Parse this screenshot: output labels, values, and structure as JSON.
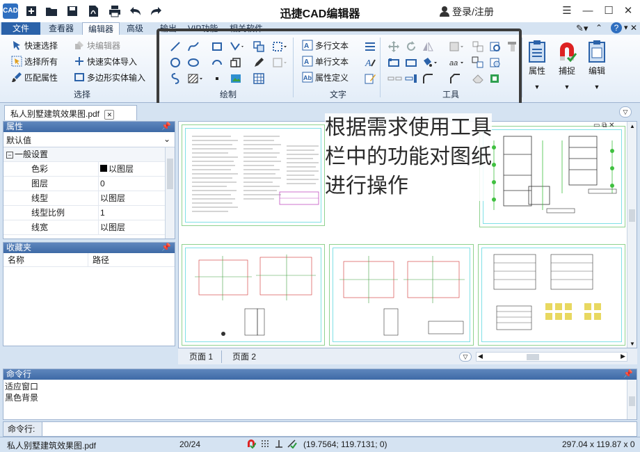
{
  "app": {
    "title": "迅捷CAD编辑器",
    "logo_text": "CAD",
    "login_label": "登录/注册"
  },
  "quick_access": [
    "new-icon",
    "open-icon",
    "save-icon",
    "export-pdf-icon",
    "print-icon",
    "undo-icon",
    "redo-icon"
  ],
  "window_controls": [
    "menu-icon",
    "minimize-icon",
    "maximize-icon",
    "close-icon"
  ],
  "tabs": [
    {
      "label": "文件"
    },
    {
      "label": "查看器"
    },
    {
      "label": "编辑器"
    },
    {
      "label": "高级"
    },
    {
      "label": "输出"
    },
    {
      "label": "VIP功能"
    },
    {
      "label": "相关软件"
    }
  ],
  "active_tab": "编辑器",
  "ribbon": {
    "select_group": {
      "label": "选择",
      "items": [
        {
          "label": "快速选择",
          "enabled": true
        },
        {
          "label": "块编辑器",
          "enabled": false
        },
        {
          "label": "选择所有",
          "enabled": true
        },
        {
          "label": "快速实体导入",
          "enabled": true
        },
        {
          "label": "匹配属性",
          "enabled": true
        },
        {
          "label": "多边形实体输入",
          "enabled": true
        }
      ]
    },
    "draw_group": {
      "label": "绘制"
    },
    "text_group": {
      "label": "文字",
      "items": [
        {
          "label": "多行文本"
        },
        {
          "label": "单行文本"
        },
        {
          "label": "属性定义"
        }
      ]
    },
    "tools_group": {
      "label": "工具"
    },
    "big_buttons": [
      {
        "label": "属性"
      },
      {
        "label": "捕捉"
      },
      {
        "label": "编辑"
      }
    ]
  },
  "document_tab": "私人别墅建筑效果图.pdf",
  "properties_panel": {
    "title": "属性",
    "combo_value": "默认值",
    "section": "一般设置",
    "rows": [
      {
        "key": "色彩",
        "value": "以图层"
      },
      {
        "key": "图层",
        "value": "0"
      },
      {
        "key": "线型",
        "value": "以图层"
      },
      {
        "key": "线型比例",
        "value": "1"
      },
      {
        "key": "线宽",
        "value": "以图层"
      }
    ]
  },
  "favorites_panel": {
    "title": "收藏夹",
    "columns": [
      "名称",
      "路径"
    ]
  },
  "annotation_text": "根据需求使用工具栏中的功能对图纸进行操作",
  "page_tabs": [
    "页面 1",
    "页面 2"
  ],
  "command_panel": {
    "title": "命令行",
    "lines": [
      "适应窗口",
      "黑色背景"
    ],
    "input_label": "命令行:"
  },
  "status": {
    "filename": "私人别墅建筑效果图.pdf",
    "page_count": "20/24",
    "coordinates": "(19.7564; 119.7131; 0)",
    "dimensions": "297.04 x 119.87 x 0"
  },
  "colors": {
    "accent": "#2b62a9",
    "panel_header": "#4a76b0",
    "ribbon_bg": "#e3edf8",
    "highlight_frame": "#3c3c3c"
  }
}
